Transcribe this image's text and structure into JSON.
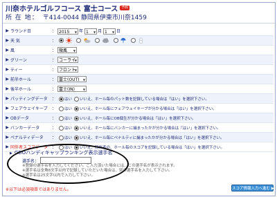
{
  "header": {
    "course_name": "川奈ホテルゴルフコース 富士コース",
    "badge": "予約",
    "address_label": "所 在 地：",
    "address": "〒414-0044 静岡県伊東市川奈1459"
  },
  "rows": {
    "round_date": {
      "label": "ラウンド日",
      "year": "2015",
      "year_unit": "年",
      "month": "1",
      "month_unit": "月",
      "day": "1",
      "day_unit": "日"
    },
    "weather": {
      "label": "天 気"
    },
    "wind": {
      "label": "風",
      "value": "微風"
    },
    "green": {
      "label": "グリーン",
      "value": "コーライ"
    },
    "tee": {
      "label": "ティー",
      "value": "フロント"
    },
    "front_hole": {
      "label": "前半ホール",
      "value": "富士(OUT)"
    },
    "back_hole": {
      "label": "後半ホール",
      "value": "富士(IN)"
    },
    "putting": {
      "label": "パッティングデータ",
      "yes": "はい",
      "no": "いいえ、ホール毎のパット数を記録している場合は「はい」を選択下さい。"
    },
    "fairway": {
      "label": "フェアウェイキープ",
      "yes": "はい",
      "no": "いいえ、ホール毎にフェアウェイキープが分かる場合は「はい」を選択下さい。"
    },
    "ob": {
      "label": "OBデータ",
      "yes": "はい",
      "no": "いいえ、ホール毎にOB個生が分かる場合は「はい」を選択下さい。"
    },
    "bunker": {
      "label": "バンカーデータ",
      "yes": "はい",
      "no": "いいえ、ホール毎にバンカーに捕まったかが分かる場合は「はい」を選択下さい。"
    },
    "penalty": {
      "label": "ペナルティデータ",
      "yes": "はい",
      "no": "いいえ、ホール毎にペナルティに捕まったかが分かる場合は「はい」を選択下さい。"
    },
    "companion": {
      "label": "同伴者スコアデータ",
      "yes": "はい",
      "no": "いいえ、同伴者の、ホール毎のスコアを記録している場合は「はい」を選択下さい。"
    }
  },
  "gdo": {
    "title": "GDOハンディキャップランキング表示選手名",
    "name_label": "選手名：",
    "name_value": "",
    "note1": "※登録の選手名を入力してください。ご入力頂いた場合には、この選手名が表示されます。",
    "note2": "※選手名は全角8文字以内で記録していただいた場合は、別の選手名を入力して下さい。",
    "note3": "※選手名は25文字以内で入力して下さい。"
  },
  "footer": {
    "required_note": "※以下は必須項目ではありません。",
    "next_button": "スコア情報入力へ進む ▶"
  },
  "colors": {
    "title": "#1c2a78",
    "required": "#d9251c",
    "button": "#3a8fd6",
    "row_alt": "#eef2fa"
  },
  "icons": {
    "weather": [
      "sun-icon",
      "partly-cloudy-icon",
      "cloud-icon",
      "rain-icon",
      "snow-icon"
    ],
    "row_arrow": "triangle-right-icon"
  }
}
